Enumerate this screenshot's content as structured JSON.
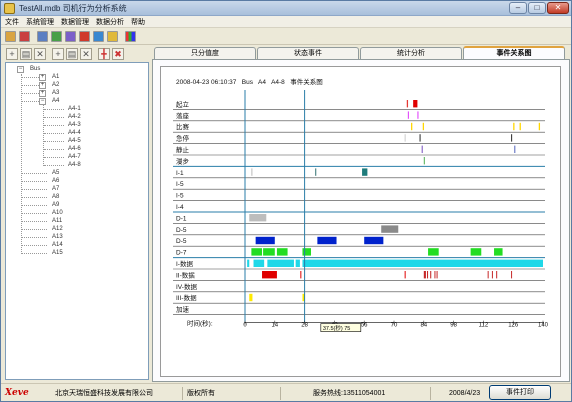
{
  "window": {
    "title": "TestAll.mdb  司机行为分析系统"
  },
  "menubar": {
    "items": [
      "文件",
      "系统管理",
      "数据管理",
      "数据分析",
      "帮助"
    ]
  },
  "toolbar": {
    "icon_names": [
      "save-icon",
      "print-icon",
      "import-icon",
      "export-icon",
      "filter-icon",
      "chart-icon",
      "report-icon",
      "help-icon",
      "bar-chart-icon"
    ]
  },
  "tree": {
    "root": "Bus",
    "top_nodes": [
      "A1",
      "A2",
      "A3",
      "A4"
    ],
    "a4_children": [
      "A4-1",
      "A4-2",
      "A4-3",
      "A4-4",
      "A4-5",
      "A4-6",
      "A4-7",
      "A4-8"
    ],
    "tail_nodes": [
      "A5",
      "A6",
      "A7",
      "A8",
      "A9",
      "A10",
      "A11",
      "A12",
      "A13",
      "A14",
      "A15"
    ]
  },
  "tabs": [
    "只分值度",
    "状态事件",
    "统计分析",
    "事件关系图"
  ],
  "chart_header": {
    "timestamp": "2008-04-23 06:10:37",
    "bus": "Bus",
    "vehicle": "A4",
    "driver": "A4-8",
    "title": "事件关系图"
  },
  "chart_data": {
    "type": "timeline",
    "xlabel": "时间(秒):",
    "x_ticks": [
      0,
      14,
      28,
      42,
      56,
      70,
      84,
      98,
      112,
      126,
      140
    ],
    "xlim": [
      0,
      140
    ],
    "cursor_times": [
      0,
      28
    ],
    "tooltip": "37.5(秒) 75",
    "rows": [
      {
        "label": "起立",
        "events": [
          {
            "start": 76,
            "end": 76.6,
            "color": "#e53935"
          },
          {
            "start": 79,
            "end": 81,
            "color": "#e00000"
          }
        ]
      },
      {
        "label": "落座",
        "events": [
          {
            "start": 76.5,
            "end": 77,
            "color": "#e040fb"
          },
          {
            "start": 81,
            "end": 81.5,
            "color": "#e040fb"
          }
        ]
      },
      {
        "label": "比赛",
        "events": [
          {
            "start": 78,
            "end": 78.6,
            "color": "#ffd600"
          },
          {
            "start": 83.5,
            "end": 84.1,
            "color": "#ffd600"
          },
          {
            "start": 126,
            "end": 126.6,
            "color": "#ffd600"
          },
          {
            "start": 129,
            "end": 129.6,
            "color": "#ffd600"
          },
          {
            "start": 138,
            "end": 138.6,
            "color": "#ffd600"
          }
        ]
      },
      {
        "label": "急停",
        "events": [
          {
            "start": 75,
            "end": 75.4,
            "color": "#cccccc"
          },
          {
            "start": 82,
            "end": 82.5,
            "color": "#333333"
          },
          {
            "start": 125,
            "end": 125.5,
            "color": "#333333"
          }
        ]
      },
      {
        "label": "静止",
        "events": [
          {
            "start": 83,
            "end": 83.5,
            "color": "#7e57c2"
          },
          {
            "start": 126.5,
            "end": 127,
            "color": "#5c6bc0"
          }
        ]
      },
      {
        "label": "漫步",
        "events": [
          {
            "start": 84,
            "end": 84.4,
            "color": "#4caf50"
          }
        ]
      },
      {
        "label": "I-1",
        "events": [
          {
            "start": 3,
            "end": 3.4,
            "color": "#bbbbbb"
          },
          {
            "start": 33,
            "end": 33.4,
            "color": "#2f6f6f"
          },
          {
            "start": 55,
            "end": 57.5,
            "color": "#1e7b7b"
          }
        ]
      },
      {
        "label": "I-5",
        "events": []
      },
      {
        "label": "I-5",
        "events": []
      },
      {
        "label": "I-4",
        "events": []
      },
      {
        "label": "D-1",
        "events": [
          {
            "start": 2,
            "end": 10,
            "color": "#bdbdbd"
          }
        ]
      },
      {
        "label": "D-5",
        "events": [
          {
            "start": 64,
            "end": 72,
            "color": "#8a8a8a"
          }
        ]
      },
      {
        "label": "D-5",
        "events": [
          {
            "start": 5,
            "end": 14,
            "color": "#0022cc"
          },
          {
            "start": 34,
            "end": 43,
            "color": "#0022cc"
          },
          {
            "start": 56,
            "end": 65,
            "color": "#0022cc"
          }
        ]
      },
      {
        "label": "D-7",
        "events": [
          {
            "start": 3,
            "end": 8,
            "color": "#22dd22"
          },
          {
            "start": 8.5,
            "end": 14,
            "color": "#22dd22"
          },
          {
            "start": 15,
            "end": 20,
            "color": "#22dd22"
          },
          {
            "start": 27,
            "end": 31,
            "color": "#22dd22"
          },
          {
            "start": 86,
            "end": 91,
            "color": "#22dd22"
          },
          {
            "start": 106,
            "end": 111,
            "color": "#22dd22"
          },
          {
            "start": 117,
            "end": 121,
            "color": "#22dd22"
          }
        ]
      },
      {
        "label": "I-数据",
        "events": [
          {
            "start": 1,
            "end": 2,
            "color": "#20d8e8"
          },
          {
            "start": 4,
            "end": 9,
            "color": "#20d8e8"
          },
          {
            "start": 10.5,
            "end": 23,
            "color": "#20d8e8"
          },
          {
            "start": 23.8,
            "end": 25.8,
            "color": "#20d8e8"
          },
          {
            "start": 27,
            "end": 140,
            "color": "#20d8e8"
          }
        ]
      },
      {
        "label": "II-数据",
        "events": [
          {
            "start": 8,
            "end": 15,
            "color": "#e00000"
          },
          {
            "start": 26,
            "end": 26.4,
            "color": "#e00000"
          },
          {
            "start": 75,
            "end": 75.4,
            "color": "#e00000"
          },
          {
            "start": 84,
            "end": 85,
            "color": "#c62828"
          },
          {
            "start": 85.5,
            "end": 86,
            "color": "#c62828"
          },
          {
            "start": 87,
            "end": 87.5,
            "color": "#c62828"
          },
          {
            "start": 89,
            "end": 89.4,
            "color": "#c62828"
          },
          {
            "start": 90,
            "end": 90.4,
            "color": "#c62828"
          },
          {
            "start": 114,
            "end": 114.4,
            "color": "#c62828"
          },
          {
            "start": 116,
            "end": 116.4,
            "color": "#c62828"
          },
          {
            "start": 118,
            "end": 118.4,
            "color": "#c62828"
          },
          {
            "start": 125,
            "end": 125.4,
            "color": "#c62828"
          }
        ]
      },
      {
        "label": "IV-数据",
        "events": []
      },
      {
        "label": "III-数据",
        "events": [
          {
            "start": 2,
            "end": 3.5,
            "color": "#ffea00"
          },
          {
            "start": 27,
            "end": 28,
            "color": "#ffea00"
          }
        ]
      },
      {
        "label": "加速",
        "events": []
      }
    ]
  },
  "statusbar": {
    "company": "北京天瑞恒盛科技发展有限公司",
    "rights": "版权所有",
    "phone": "服务热线:13511054001",
    "date": "2008/4/23",
    "action_button": "事件打印",
    "logo": "Xeve"
  },
  "colors": {
    "accent": "#e0a33f",
    "axis": "#2a7ea8",
    "separator": "#2a7ea8"
  }
}
